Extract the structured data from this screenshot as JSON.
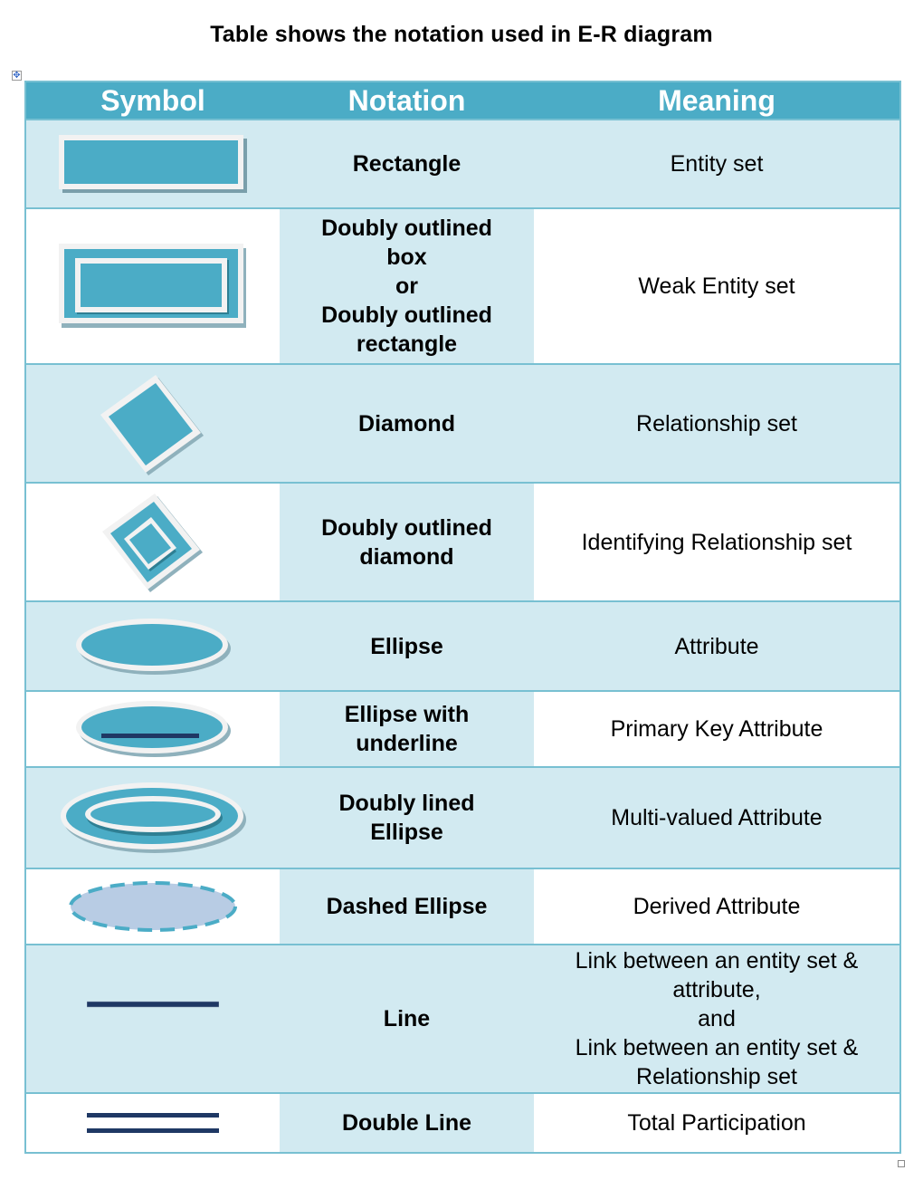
{
  "title": "Table shows the notation used in E-R diagram",
  "colors": {
    "header_bg": "#4bacc6",
    "band_bg": "#d2eaf1",
    "border": "#78c0d2",
    "symbol_fill": "#4bacc6",
    "symbol_outline": "#f2f2f2",
    "line_color": "#1f3864",
    "dashed_fill": "#b8cce4"
  },
  "table": {
    "headers": [
      "Symbol",
      "Notation",
      "Meaning"
    ],
    "rows": [
      {
        "symbol": "rectangle-icon",
        "notation": "Rectangle",
        "meaning": "Entity set"
      },
      {
        "symbol": "double-rectangle-icon",
        "notation": "Doubly outlined\nbox\nor\nDoubly outlined\nrectangle",
        "meaning": "Weak Entity set"
      },
      {
        "symbol": "diamond-icon",
        "notation": "Diamond",
        "meaning": "Relationship set"
      },
      {
        "symbol": "double-diamond-icon",
        "notation": "Doubly outlined\ndiamond",
        "meaning": "Identifying Relationship set"
      },
      {
        "symbol": "ellipse-icon",
        "notation": "Ellipse",
        "meaning": "Attribute"
      },
      {
        "symbol": "underlined-ellipse-icon",
        "notation": "Ellipse with\nunderline",
        "meaning": "Primary Key Attribute"
      },
      {
        "symbol": "double-ellipse-icon",
        "notation": "Doubly lined\nEllipse",
        "meaning": "Multi-valued Attribute"
      },
      {
        "symbol": "dashed-ellipse-icon",
        "notation": "Dashed Ellipse",
        "meaning": "Derived Attribute"
      },
      {
        "symbol": "line-icon",
        "notation": "Line",
        "meaning": "Link between an entity set &\nattribute,\nand\nLink between an entity set &\nRelationship set"
      },
      {
        "symbol": "double-line-icon",
        "notation": "Double Line",
        "meaning": "Total Participation"
      }
    ]
  }
}
